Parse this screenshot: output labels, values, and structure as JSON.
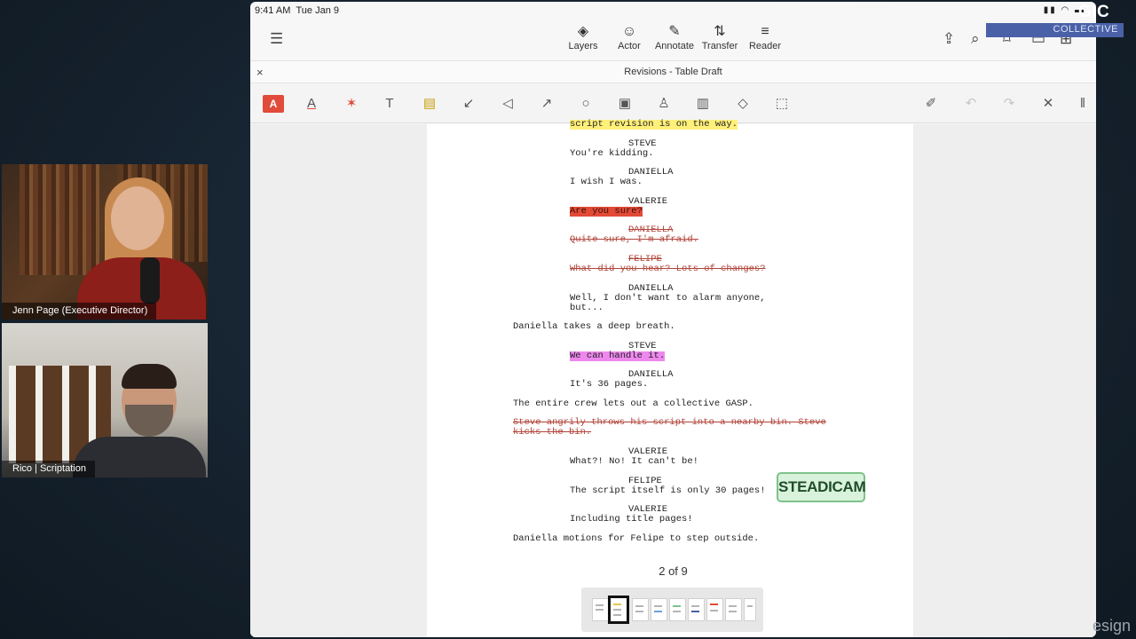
{
  "participants": [
    {
      "name": "Jenn Page (Executive Director)"
    },
    {
      "name": "Rico | Scriptation"
    }
  ],
  "status_bar": {
    "time": "9:41 AM",
    "date": "Tue Jan 9"
  },
  "overlay_brand": {
    "text": "GIC",
    "subtext": "COLLECTIVE"
  },
  "toolbar": {
    "tools": [
      {
        "label": "Layers",
        "icon": "layers-icon"
      },
      {
        "label": "Actor",
        "icon": "actor-masks-icon"
      },
      {
        "label": "Annotate",
        "icon": "pencil-icon"
      },
      {
        "label": "Transfer",
        "icon": "transfer-icon"
      },
      {
        "label": "Reader",
        "icon": "reader-lines-icon"
      }
    ]
  },
  "document": {
    "title": "Revisions - Table Draft",
    "close_label": "×"
  },
  "annotation_tools": [
    "highlighter",
    "text-color",
    "strikethrough",
    "text",
    "comment",
    "pen",
    "lasso",
    "arrow",
    "circle",
    "image",
    "stamp",
    "note",
    "eraser",
    "select-area"
  ],
  "annotation_right_tools": [
    "pen-settings",
    "undo",
    "redo",
    "close",
    "more"
  ],
  "script_lines": [
    {
      "text": "script revision is on the way.",
      "style": "hl-yellow"
    },
    {
      "text": "STEVE",
      "style": ""
    },
    {
      "text": "You're kidding.",
      "style": ""
    },
    {
      "text": "DANIELLA",
      "style": ""
    },
    {
      "text": "I wish I was.",
      "style": ""
    },
    {
      "text": "VALERIE",
      "style": ""
    },
    {
      "text": "Are you sure?",
      "style": "hl-red"
    },
    {
      "text": "DANIELLA",
      "style": "strike"
    },
    {
      "text": "Quite sure, I'm afraid.",
      "style": "strike"
    },
    {
      "text": "FELIPE",
      "style": "strike"
    },
    {
      "text": "What did you hear? Lots of changes?",
      "style": "strike"
    },
    {
      "text": "DANIELLA",
      "style": ""
    },
    {
      "text": "Well, I don't want to alarm anyone,",
      "style": ""
    },
    {
      "text": "but...",
      "style": ""
    },
    {
      "text": "Daniella takes a deep breath.",
      "style": ""
    },
    {
      "text": "STEVE",
      "style": ""
    },
    {
      "text": "We can handle it.",
      "style": "hl-pink"
    },
    {
      "text": "DANIELLA",
      "style": ""
    },
    {
      "text": "It's 36 pages.",
      "style": ""
    },
    {
      "text": "The entire crew lets out a collective GASP.",
      "style": ""
    },
    {
      "text": "Steve angrily throws his script into a nearby bin. Steve",
      "style": "strike"
    },
    {
      "text": "kicks the bin.",
      "style": "strike"
    },
    {
      "text": "VALERIE",
      "style": ""
    },
    {
      "text": "What?! No! It can't be!",
      "style": ""
    },
    {
      "text": "FELIPE",
      "style": ""
    },
    {
      "text": "The script itself is only 30 pages!",
      "style": ""
    },
    {
      "text": "VALERIE",
      "style": ""
    },
    {
      "text": "Including title pages!",
      "style": ""
    },
    {
      "text": "Daniella motions for Felipe to step outside.",
      "style": ""
    }
  ],
  "stamp_label": "STEADICAM",
  "pager": {
    "label": "2 of 9",
    "current": 2,
    "total": 9
  },
  "watermark_text": "esign",
  "colors": {
    "highlight_red": "#e24a36",
    "highlight_pink": "#ee88ee",
    "highlight_yellow": "#fff07a",
    "stamp_green": "#d9f2dc",
    "brand_blue": "#4a61a8"
  }
}
